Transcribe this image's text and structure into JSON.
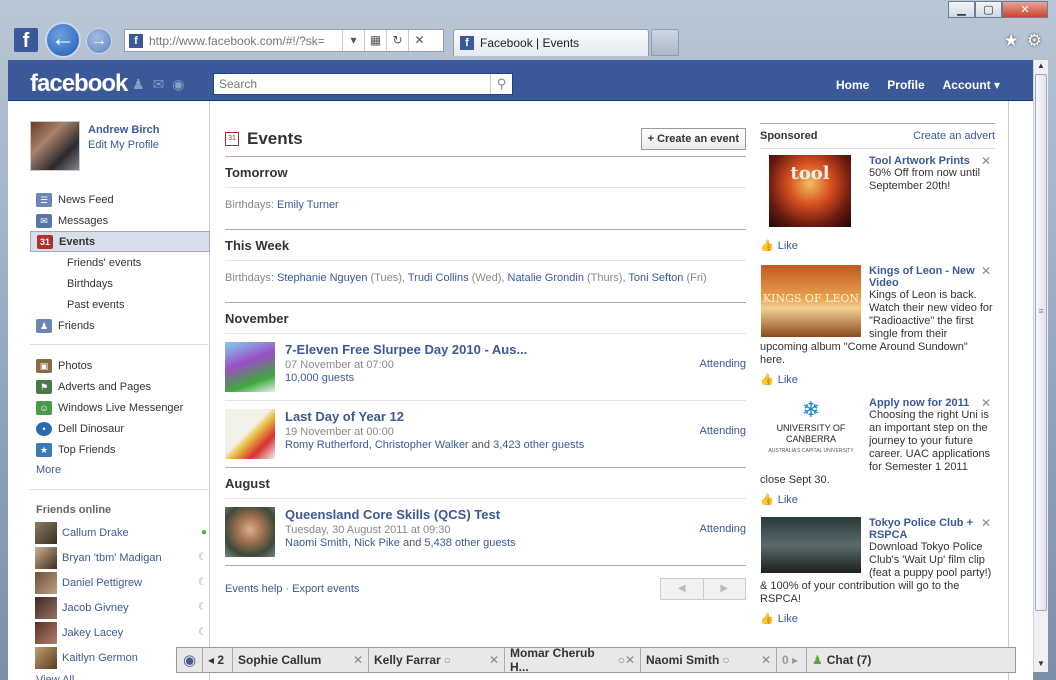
{
  "browser": {
    "url": "http://www.facebook.com/#!/?sk=",
    "tab_title": "Facebook | Events",
    "min": "▁",
    "max": "▢",
    "close": "✕"
  },
  "header": {
    "logo": "facebook",
    "search_placeholder": "Search",
    "nav": [
      "Home",
      "Profile",
      "Account ▾"
    ]
  },
  "profile": {
    "name": "Andrew Birch",
    "edit": "Edit My Profile"
  },
  "menu": [
    {
      "label": "News Feed",
      "icon": "news-feed-icon",
      "color": "#6d84b4"
    },
    {
      "label": "Messages",
      "icon": "messages-icon",
      "color": "#5b74a8"
    },
    {
      "label": "Events",
      "icon": "events-icon",
      "color": "#b03030",
      "selected": true
    },
    {
      "label": "Friends' events",
      "sub": true
    },
    {
      "label": "Birthdays",
      "sub": true
    },
    {
      "label": "Past events",
      "sub": true
    },
    {
      "label": "Friends",
      "icon": "friends-icon",
      "color": "#6d84b4"
    }
  ],
  "menu2": [
    {
      "label": "Photos",
      "icon": "photos-icon",
      "color": "#8a6a40"
    },
    {
      "label": "Adverts and Pages",
      "icon": "adverts-icon",
      "color": "#4a7a4a"
    },
    {
      "label": "Windows Live Messenger",
      "icon": "messenger-icon",
      "color": "#4a9a4a"
    },
    {
      "label": "Dell Dinosaur",
      "icon": "dell-icon",
      "color": "#2a6ab0"
    },
    {
      "label": "Top Friends",
      "icon": "star-icon",
      "color": "#3a7ab8"
    }
  ],
  "more": "More",
  "friends_online": {
    "title": "Friends online",
    "view_all": "View All",
    "list": [
      {
        "name": "Callum Drake",
        "status": "●",
        "status_color": "#5aaa3a"
      },
      {
        "name": "Bryan 'tbm' Madigan",
        "status": "☾",
        "status_color": "#99a"
      },
      {
        "name": "Daniel Pettigrew",
        "status": "☾",
        "status_color": "#99a"
      },
      {
        "name": "Jacob Givney",
        "status": "☾",
        "status_color": "#99a"
      },
      {
        "name": "Jakey Lacey",
        "status": "☾",
        "status_color": "#99a"
      },
      {
        "name": "Kaitlyn Germon",
        "status": "☾",
        "status_color": "#99a"
      }
    ]
  },
  "events": {
    "title": "Events",
    "create": "+ Create an event",
    "tomorrow": {
      "heading": "Tomorrow",
      "label": "Birthdays:",
      "names": "Emily Turner"
    },
    "week": {
      "heading": "This Week",
      "label": "Birthdays:",
      "items": [
        {
          "name": "Stephanie Nguyen",
          "day": " (Tues), "
        },
        {
          "name": "Trudi Collins",
          "day": " (Wed), "
        },
        {
          "name": "Natalie Grondin",
          "day": " (Thurs), "
        },
        {
          "name": "Toni Sefton",
          "day": " (Fri)"
        }
      ]
    },
    "november": "November",
    "august": "August",
    "list": [
      {
        "title": "7-Eleven Free Slurpee Day 2010 - Aus...",
        "date": "07 November at 07:00",
        "meta": "10,000 guests",
        "meta2": "",
        "status": "Attending"
      },
      {
        "title": "Last Day of Year 12",
        "date": "19 November at 00:00",
        "meta": "Romy Rutherford, Christopher Walker",
        "meta2": " and ",
        "meta3": "3,423 other guests",
        "status": "Attending"
      },
      {
        "title": "Queensland Core Skills (QCS) Test",
        "date": "Tuesday, 30 August 2011 at 09:30",
        "meta": "Naomi Smith, Nick Pike",
        "meta2": " and ",
        "meta3": "5,438 other guests",
        "status": "Attending"
      }
    ],
    "help": "Events help",
    "export": "Export events",
    "dot": "·",
    "prev": "◀",
    "next": "▶"
  },
  "sponsored": {
    "title": "Sponsored",
    "create": "Create an advert",
    "like": "Like",
    "ads": [
      {
        "title": "Tool Artwork Prints",
        "body": "50% Off from now until September 20th!"
      },
      {
        "title": "Kings of Leon - New Video",
        "body": "Kings of Leon is back. Watch their new video for \"Radioactive\" the first single from their upcoming album \"Come Around Sundown\" here."
      },
      {
        "title": "Apply now for 2011",
        "body": "Choosing the right Uni is an important step on the journey to your future career. UAC applications for Semester 1 2011 close Sept 30."
      },
      {
        "title": "Tokyo Police Club + RSPCA",
        "body": "Download Tokyo Police Club's 'Wait Up' film clip (feat a puppy pool party!) & 100% of your contribution will go to the RSPCA!"
      }
    ],
    "img_texts": [
      "tool",
      "KINGS OF LEON",
      "UNIVERSITY OF CANBERRA",
      "AUSTRALIA'S CAPITAL UNIVERSITY"
    ]
  },
  "chatbar": {
    "count": "◂ 2",
    "tabs": [
      "Sophie Callum",
      "Kelly Farrar",
      "Momar Cherub H...",
      "Naomi Smith"
    ],
    "overflow": "0 ▸",
    "chat": "Chat (7)"
  }
}
